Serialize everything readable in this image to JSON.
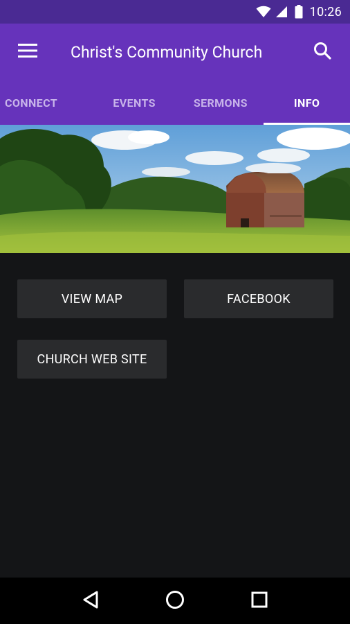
{
  "status_bar": {
    "time": "10:26",
    "icons": [
      "wifi-icon",
      "cell-signal-icon",
      "battery-icon"
    ]
  },
  "app_bar": {
    "title": "Christ's Community Church",
    "menu_icon": "hamburger-menu-icon",
    "search_icon": "search-icon"
  },
  "tabs": [
    {
      "label": "CONNECT",
      "active": false
    },
    {
      "label": "EVENTS",
      "active": false
    },
    {
      "label": "SERMONS",
      "active": false
    },
    {
      "label": "INFO",
      "active": true
    }
  ],
  "hero_image": {
    "subject": "red barn in green field"
  },
  "buttons": {
    "view_map": "VIEW MAP",
    "facebook": "FACEBOOK",
    "church_web_site": "CHURCH WEB SITE"
  },
  "nav_bar": {
    "icons": [
      "back-icon",
      "home-icon",
      "recents-icon"
    ]
  },
  "colors": {
    "primary": "#6633bb",
    "primary_dark": "#4a2a93",
    "background": "#141517",
    "button": "#2a2b2d"
  }
}
